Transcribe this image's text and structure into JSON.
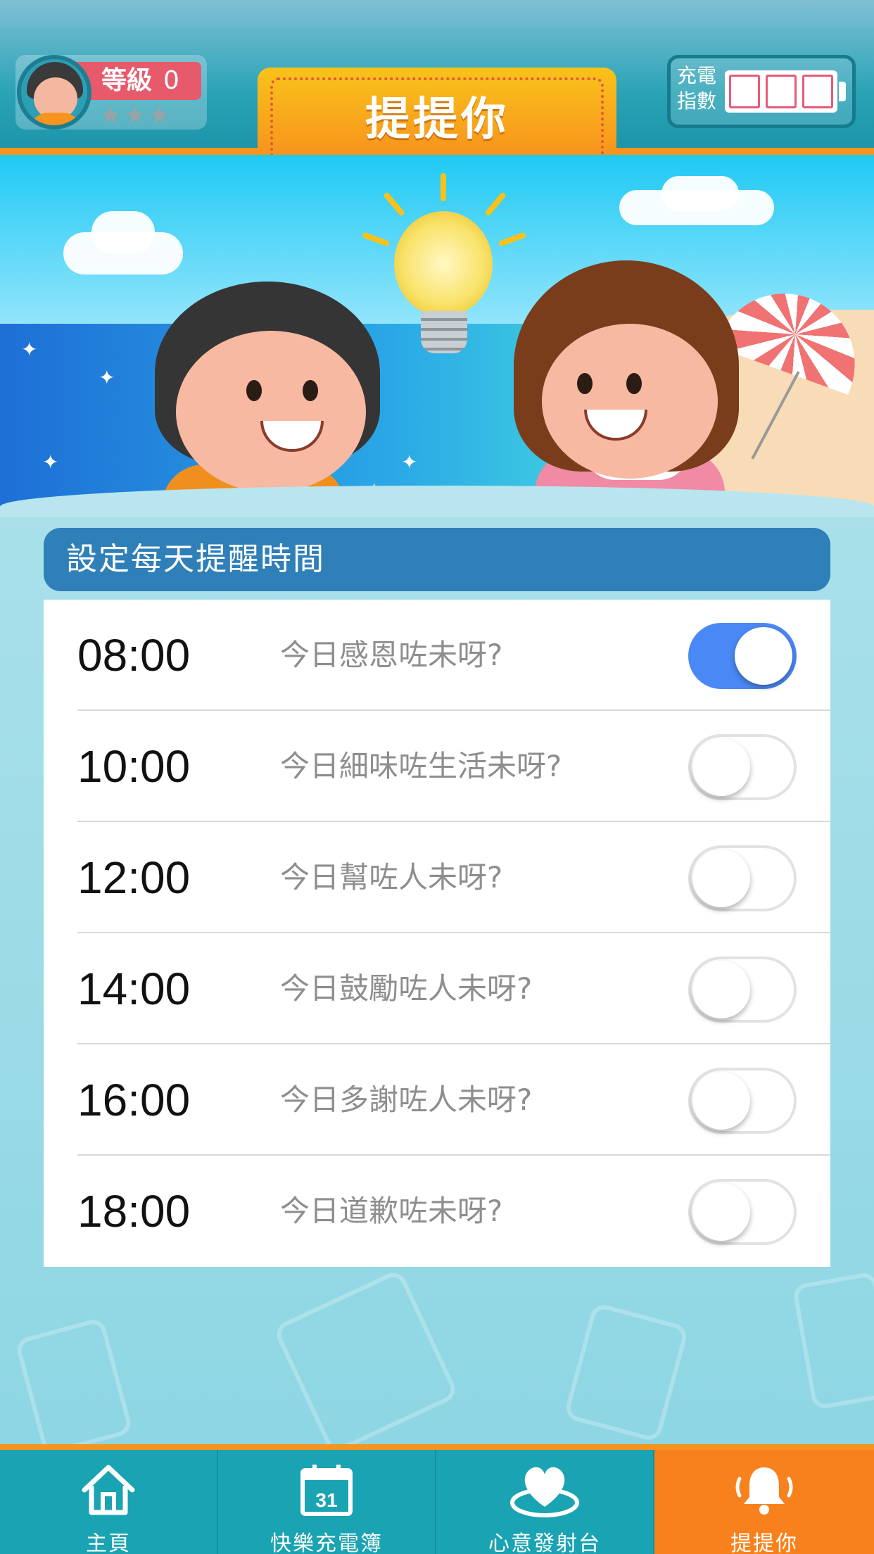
{
  "header": {
    "level_label": "等級",
    "level_value": "0",
    "stars": "★★★",
    "title": "提提你",
    "charge_label": "充電指數"
  },
  "reminder": {
    "section_title": "設定每天提醒時間",
    "items": [
      {
        "time": "08:00",
        "message": "今日感恩咗未呀?",
        "enabled": true
      },
      {
        "time": "10:00",
        "message": "今日細味咗生活未呀?",
        "enabled": false
      },
      {
        "time": "12:00",
        "message": "今日幫咗人未呀?",
        "enabled": false
      },
      {
        "time": "14:00",
        "message": "今日鼓勵咗人未呀?",
        "enabled": false
      },
      {
        "time": "16:00",
        "message": "今日多謝咗人未呀?",
        "enabled": false
      },
      {
        "time": "18:00",
        "message": "今日道歉咗未呀?",
        "enabled": false
      }
    ]
  },
  "tabbar": {
    "tabs": [
      {
        "label": "主頁",
        "icon": "home-icon",
        "active": false
      },
      {
        "label": "快樂充電簿",
        "icon": "calendar-icon",
        "calendar_day": "31",
        "active": false
      },
      {
        "label": "心意發射台",
        "icon": "heart-icon",
        "active": false
      },
      {
        "label": "提提你",
        "icon": "bell-icon",
        "active": true
      }
    ]
  },
  "colors": {
    "accent_orange": "#f7941d",
    "header_teal": "#1b93a8",
    "section_blue": "#2f7fb8",
    "toggle_on": "#4a88f5"
  }
}
